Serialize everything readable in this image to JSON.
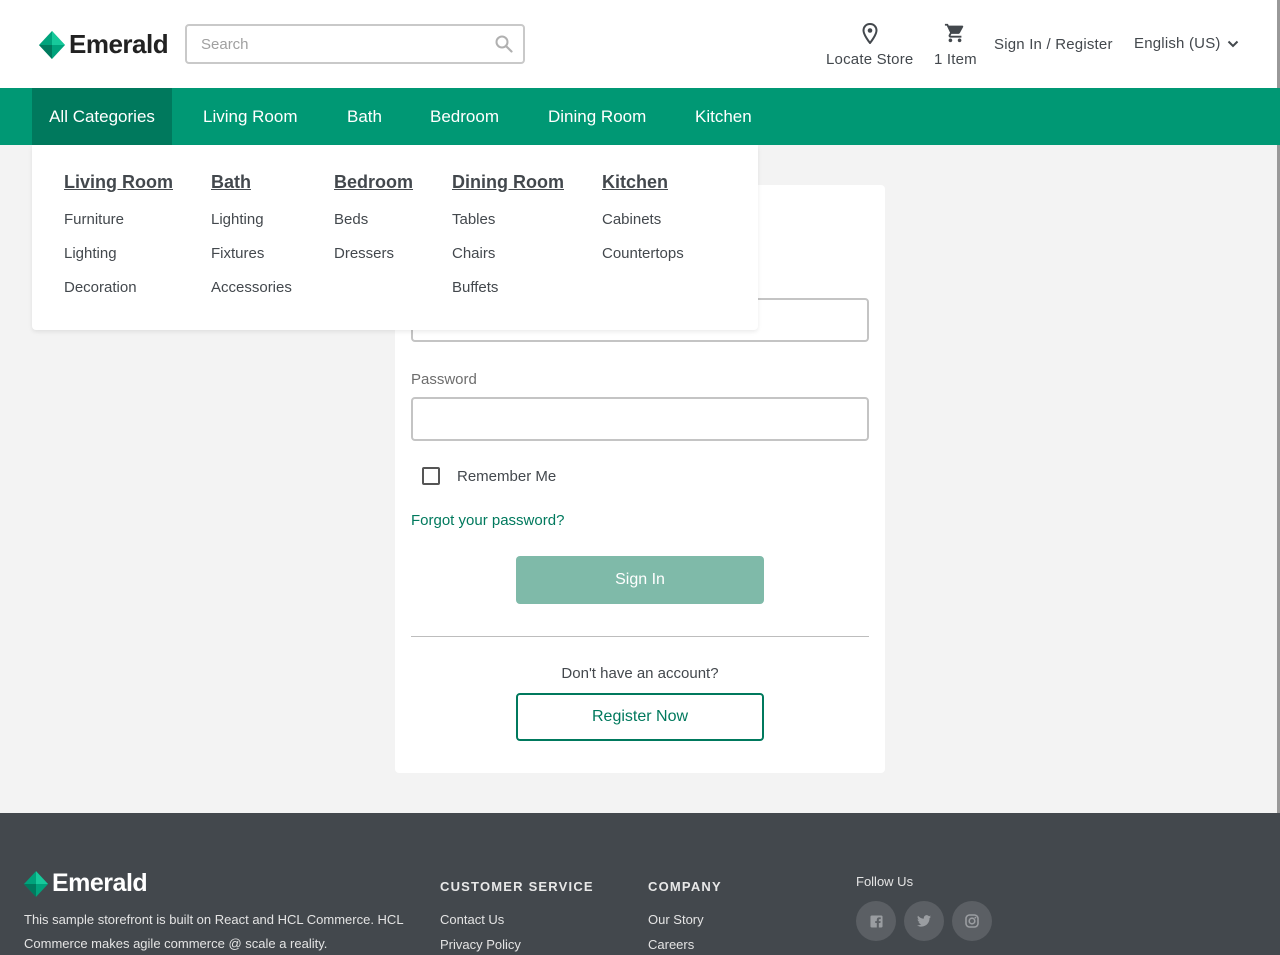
{
  "brand": {
    "name": "Emerald",
    "accent": "#009874",
    "accent_dark": "#00795d"
  },
  "header": {
    "search_placeholder": "Search",
    "locate_label": "Locate Store",
    "cart_label": "1 Item",
    "signin_label": "Sign In / Register",
    "language_label": "English (US)"
  },
  "nav": {
    "items": [
      "All Categories",
      "Living Room",
      "Bath",
      "Bedroom",
      "Dining Room",
      "Kitchen"
    ]
  },
  "mega_menu": {
    "columns": [
      {
        "title": "Living Room",
        "links": [
          "Furniture",
          "Lighting",
          "Decoration"
        ]
      },
      {
        "title": "Bath",
        "links": [
          "Lighting",
          "Fixtures",
          "Accessories"
        ]
      },
      {
        "title": "Bedroom",
        "links": [
          "Beds",
          "Dressers"
        ]
      },
      {
        "title": "Dining Room",
        "links": [
          "Tables",
          "Chairs",
          "Buffets"
        ]
      },
      {
        "title": "Kitchen",
        "links": [
          "Cabinets",
          "Countertops"
        ]
      }
    ]
  },
  "signin": {
    "email_value": "",
    "password_label": "Password",
    "password_value": "",
    "remember_label": "Remember Me",
    "remember_checked": false,
    "forgot_label": "Forgot your password?",
    "signin_button": "Sign In",
    "no_account": "Don't have an account?",
    "register_button": "Register Now"
  },
  "footer": {
    "description": "This sample storefront is built on React and HCL Commerce. HCL Commerce makes agile commerce @ scale a reality.",
    "customer_service": {
      "title": "CUSTOMER SERVICE",
      "links": [
        "Contact Us",
        "Privacy Policy"
      ]
    },
    "company": {
      "title": "COMPANY",
      "links": [
        "Our Story",
        "Careers"
      ]
    },
    "follow_label": "Follow Us",
    "social_icons": [
      "facebook-icon",
      "twitter-icon",
      "instagram-icon"
    ]
  }
}
